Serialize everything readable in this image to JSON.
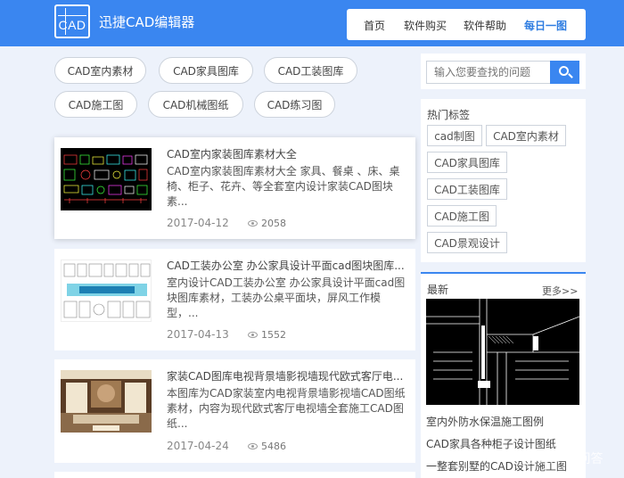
{
  "header": {
    "logo_text": "CAD",
    "brand": "迅捷CAD编辑器",
    "nav": [
      "首页",
      "软件购买",
      "软件帮助",
      "每日一图"
    ]
  },
  "tags": [
    "CAD室内素材",
    "CAD家具图库",
    "CAD工装图库",
    "CAD施工图",
    "CAD机械图纸",
    "CAD练习图"
  ],
  "articles": [
    {
      "title": "CAD室内家装图库素材大全",
      "desc": "CAD室内家装图库素材大全 家具、餐桌 、床、桌椅、柜子、花卉、等全套室内设计家装CAD图块素...",
      "date": "2017-04-12",
      "views": "2058"
    },
    {
      "title": "CAD工装办公室 办公家具设计平面cad图块图库...",
      "desc": "室内设计CAD工装办公室 办公家具设计平面cad图块图库素材，工装办公桌平面块，屏风工作模型，...",
      "date": "2017-04-13",
      "views": "1552"
    },
    {
      "title": "家装CAD图库电视背景墙影视墙现代欧式客厅电...",
      "desc": "本图库为CAD家装室内电视背景墙影视墙CAD图纸素材，内容为现代欧式客厅电视墙全套施工CAD图纸...",
      "date": "2017-04-24",
      "views": "5486"
    }
  ],
  "sidebar": {
    "search_placeholder": "输入您要查找的问题",
    "hot_title": "热门标签",
    "hot_tags": [
      "cad制图",
      "CAD室内素材",
      "CAD家具图库",
      "CAD工装图库",
      "CAD施工图",
      "CAD景观设计"
    ],
    "latest_title": "最新",
    "more": "更多>>",
    "latest_links": [
      "室内外防水保温施工图例",
      "CAD家具各种柜子设计图纸",
      "一整套别墅的CAD设计施工图"
    ]
  },
  "watermark": "头条 @问答",
  "colors": {
    "accent": "#3a86f0",
    "active_nav": "#2f7de1",
    "background": "#edf2fb"
  },
  "icons": [
    "logo-icon",
    "search-icon",
    "eye-icon"
  ]
}
